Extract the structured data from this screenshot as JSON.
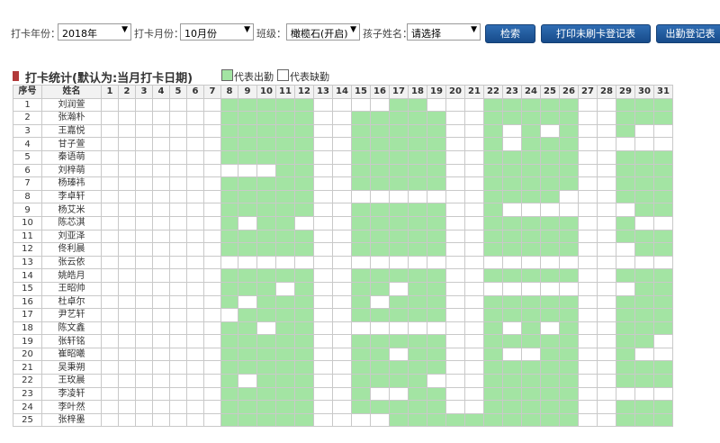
{
  "toolbar": {
    "year_label": "打卡年份：",
    "year_value": "2018年",
    "month_label": "打卡月份：",
    "month_value": "10月份",
    "class_label": "班级：",
    "class_value": "橄榄石(开启)",
    "child_label": "孩子姓名：",
    "child_value": "请选择",
    "search_btn": "检索",
    "print_btn": "打印未刷卡登记表",
    "attend_btn": "出勤登记表"
  },
  "title": {
    "text": "打卡统计(默认为:当月打卡日期)",
    "legend_present": "代表出勤",
    "legend_absent": "代表缺勤"
  },
  "colors": {
    "present": "#a3e4a3",
    "absent": "#ffffff"
  },
  "table": {
    "col_index": "序号",
    "col_name": "姓名",
    "days": [
      "1",
      "2",
      "3",
      "4",
      "5",
      "6",
      "7",
      "8",
      "9",
      "10",
      "11",
      "12",
      "13",
      "14",
      "15",
      "16",
      "17",
      "18",
      "19",
      "20",
      "21",
      "22",
      "23",
      "24",
      "25",
      "26",
      "27",
      "28",
      "29",
      "30",
      "31"
    ],
    "rows": [
      {
        "no": "1",
        "name": "刘润萱",
        "att": "0000000111110000110001111100111"
      },
      {
        "no": "2",
        "name": "张瀚朴",
        "att": "0000000111110011111001111100111"
      },
      {
        "no": "3",
        "name": "王嘉悦",
        "att": "0000000111110011111001010100100"
      },
      {
        "no": "4",
        "name": "甘子萱",
        "att": "0000000111110011111001011100000"
      },
      {
        "no": "5",
        "name": "秦语萌",
        "att": "0000000111110011111001111100111"
      },
      {
        "no": "6",
        "name": "刘梓萌",
        "att": "0000000000110011111001111100111"
      },
      {
        "no": "7",
        "name": "杨瑧祎",
        "att": "0000000111110011111001111100111"
      },
      {
        "no": "8",
        "name": "李卓轩",
        "att": "0000000111110000000001111000111"
      },
      {
        "no": "9",
        "name": "杨艾米",
        "att": "0000000111110011111001000000011"
      },
      {
        "no": "10",
        "name": "陈芯淇",
        "att": "0000000101100011111001111100100"
      },
      {
        "no": "11",
        "name": "刘亚泽",
        "att": "0000000111110011111001111100111"
      },
      {
        "no": "12",
        "name": "佟利晨",
        "att": "0000000111110011111001111100011"
      },
      {
        "no": "13",
        "name": "张云依",
        "att": "0000000000000000000000000000000"
      },
      {
        "no": "14",
        "name": "姚皓月",
        "att": "0000000111110011111001111100111"
      },
      {
        "no": "15",
        "name": "王昭帅",
        "att": "0000000111010011011000000000011"
      },
      {
        "no": "16",
        "name": "杜卓尔",
        "att": "0000000101110010111001111100111"
      },
      {
        "no": "17",
        "name": "尹艺轩",
        "att": "0000000011110011111001111100111"
      },
      {
        "no": "18",
        "name": "陈文鑫",
        "att": "0000000110110000000001010100111"
      },
      {
        "no": "19",
        "name": "张轩铭",
        "att": "0000000111110011111001111100110"
      },
      {
        "no": "20",
        "name": "崔昭曦",
        "att": "0000000111110011011001001100100"
      },
      {
        "no": "21",
        "name": "吴秉朔",
        "att": "0000000111110011111001111100111"
      },
      {
        "no": "22",
        "name": "王玫晨",
        "att": "0000000101110011110001111100111"
      },
      {
        "no": "23",
        "name": "李凌轩",
        "att": "0000000111110010011001111100000"
      },
      {
        "no": "24",
        "name": "李叶然",
        "att": "0000000111110011111001111100111"
      },
      {
        "no": "25",
        "name": "张梓墨",
        "att": "0000000111110000111111111100111"
      }
    ]
  }
}
